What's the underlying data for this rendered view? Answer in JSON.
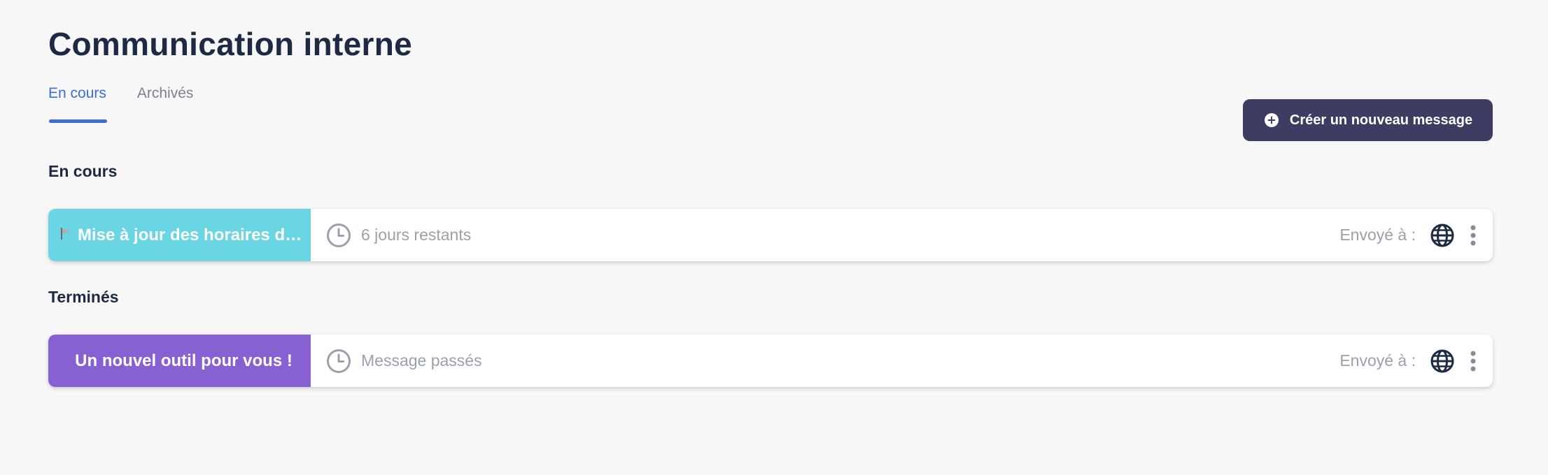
{
  "page": {
    "title": "Communication interne"
  },
  "tabs": [
    {
      "label": "En cours",
      "active": true
    },
    {
      "label": "Archivés",
      "active": false
    }
  ],
  "toolbar": {
    "create_label": "Créer un nouveau message",
    "create_icon": "plus-circle-icon"
  },
  "sections": {
    "ongoing": {
      "heading": "En cours",
      "cards": [
        {
          "title": "Mise à jour des horaires de…",
          "title_icon": "flag-emoji",
          "color": "#6ad6e3",
          "status": "6 jours restants",
          "sent_label": "Envoyé à :",
          "sent_icon": "globe-icon"
        }
      ]
    },
    "finished": {
      "heading": "Terminés",
      "cards": [
        {
          "title": "Un nouvel outil pour vous !",
          "color": "#8761d2",
          "status": "Message passés",
          "sent_label": "Envoyé à :",
          "sent_icon": "globe-icon"
        }
      ]
    }
  },
  "colors": {
    "accent": "#3c6fd1",
    "button": "#3d3d63",
    "text": "#1e2a44",
    "muted": "#9aa0ac"
  }
}
